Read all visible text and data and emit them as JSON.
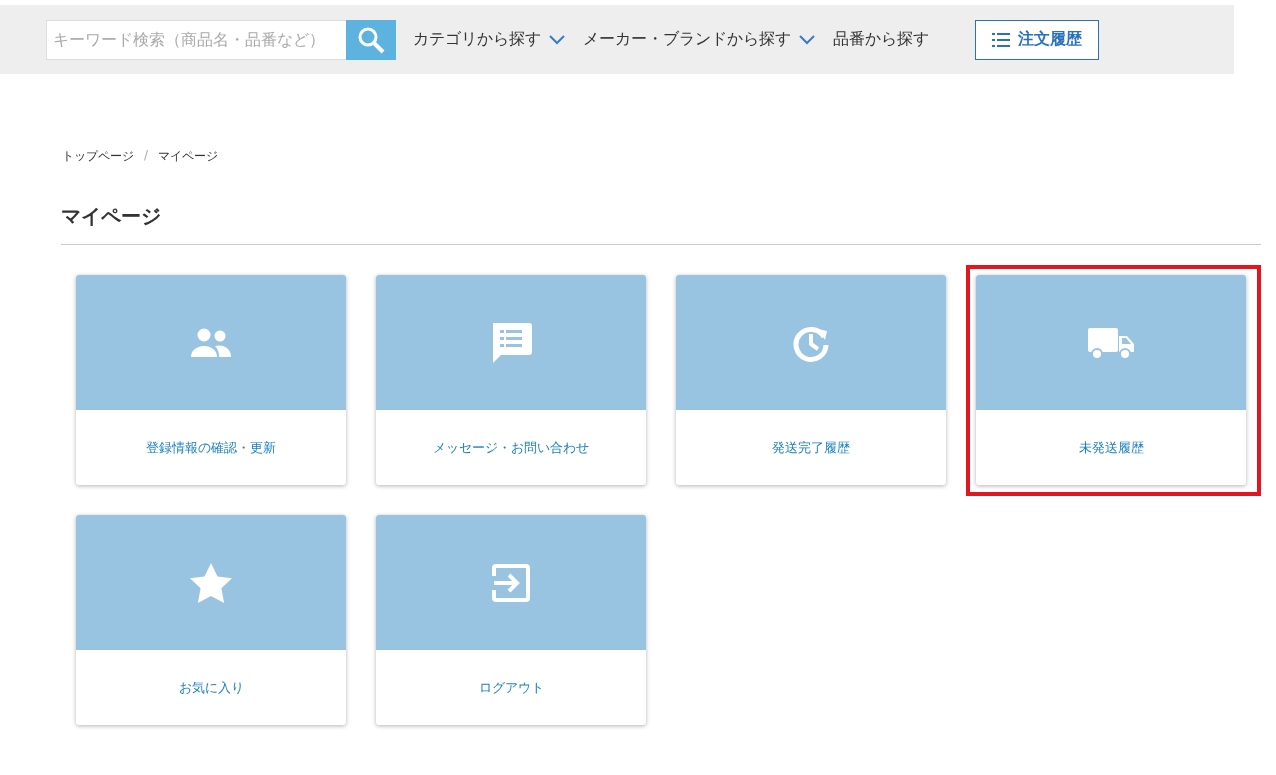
{
  "search": {
    "placeholder": "キーワード検索（商品名・品番など）"
  },
  "nav": [
    {
      "label": "カテゴリから探す",
      "kind": "dropdown"
    },
    {
      "label": "メーカー・ブランドから探す",
      "kind": "dropdown"
    },
    {
      "label": "品番から探す",
      "kind": "link"
    }
  ],
  "order_history_button": {
    "label": "注文履歴"
  },
  "breadcrumb": {
    "separator": "/",
    "items": [
      "トップページ",
      "マイページ"
    ]
  },
  "page_title": "マイページ",
  "tiles": [
    {
      "label": "登録情報の確認・更新",
      "highlighted": false
    },
    {
      "label": "メッセージ・お問い合わせ",
      "highlighted": false
    },
    {
      "label": "発送完了履歴",
      "highlighted": false
    },
    {
      "label": "未発送履歴",
      "highlighted": true
    },
    {
      "label": "お気に入り",
      "highlighted": false
    },
    {
      "label": "ログアウト",
      "highlighted": false
    }
  ]
}
